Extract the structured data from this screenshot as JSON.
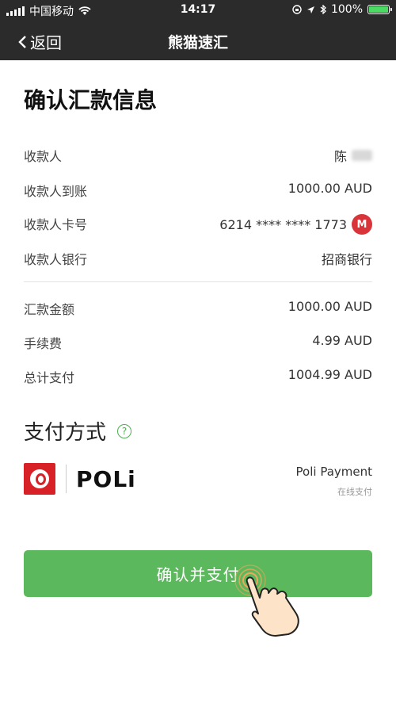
{
  "status_bar": {
    "carrier": "中国移动",
    "time": "14:17",
    "battery": "100%",
    "battery_level": 1.0,
    "battery_color": "#4cd964"
  },
  "nav": {
    "back_label": "返回",
    "title": "熊猫速汇"
  },
  "page_title": "确认汇款信息",
  "details": [
    {
      "label": "收款人",
      "value": "陈"
    },
    {
      "label": "收款人到账",
      "value": "1000.00 AUD"
    },
    {
      "label": "收款人卡号",
      "value": "6214 **** **** 1773"
    },
    {
      "label": "收款人银行",
      "value": "招商银行"
    }
  ],
  "summary": [
    {
      "label": "汇款金额",
      "value": "1000.00 AUD"
    },
    {
      "label": "手续费",
      "value": "4.99 AUD"
    },
    {
      "label": "总计支付",
      "value": "1004.99 AUD"
    }
  ],
  "payment_section": {
    "title": "支付方式",
    "help_icon": "?",
    "logo_text": "POLi",
    "method_name": "Poli Payment",
    "method_sub": "在线支付"
  },
  "confirm_button": "确认并支付",
  "colors": {
    "header_bg": "#2b2b2b",
    "accent_green": "#5cb85c",
    "bank_logo_red": "#d8343a",
    "aupost_red": "#d82027"
  },
  "icons": {
    "back": "chevron-left-icon",
    "bank": "cmb-bank-logo-icon",
    "help": "question-circle-icon",
    "pointer": "tap-hand-icon"
  }
}
